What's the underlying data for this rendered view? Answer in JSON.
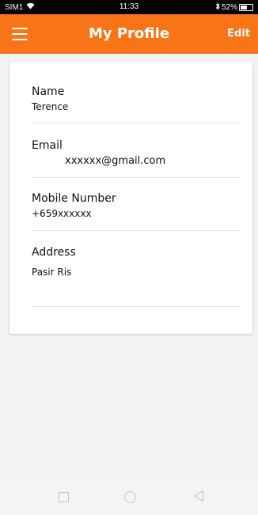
{
  "status_bar": {
    "carrier": "SIM1",
    "time": "11:33",
    "battery": "52%"
  },
  "app_bar": {
    "title": "My Profile",
    "edit_label": "Edit"
  },
  "profile": {
    "fields": [
      {
        "label": "Name",
        "value": "Terence"
      },
      {
        "label": "Email",
        "value": "xxxxxx@gmail.com"
      },
      {
        "label": "Mobile Number",
        "value": "+659xxxxxx"
      },
      {
        "label": "Address",
        "value": "Pasir Ris"
      }
    ]
  },
  "colors": {
    "accent": "#f87517",
    "background": "#f2f2f4",
    "card": "#ffffff"
  },
  "icons": {
    "menu": "hamburger-menu-icon",
    "nav_recent": "square-icon",
    "nav_home": "circle-icon",
    "nav_back": "triangle-back-icon"
  }
}
